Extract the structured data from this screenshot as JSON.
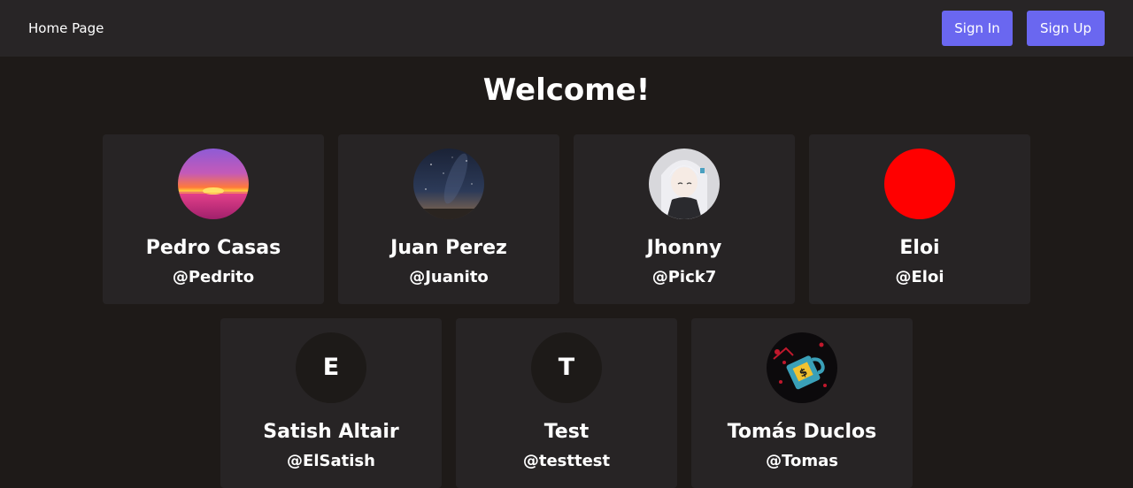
{
  "nav": {
    "home_label": "Home Page",
    "sign_in_label": "Sign In",
    "sign_up_label": "Sign Up",
    "button_color": "#6a67f0"
  },
  "title": "Welcome!",
  "users": [
    {
      "name": "Pedro Casas",
      "handle": "@Pedrito",
      "avatar": "sunset-photo"
    },
    {
      "name": "Juan Perez",
      "handle": "@Juanito",
      "avatar": "night-sky-photo"
    },
    {
      "name": "Jhonny",
      "handle": "@Pick7",
      "avatar": "anime-character-drawing"
    },
    {
      "name": "Eloi",
      "handle": "@Eloi",
      "avatar": "red-circle",
      "avatar_color": "#ff0000"
    },
    {
      "name": "Satish Altair",
      "handle": "@ElSatish",
      "avatar_letter": "E"
    },
    {
      "name": "Test",
      "handle": "@testtest",
      "avatar_letter": "T"
    },
    {
      "name": "Tomás Duclos",
      "handle": "@Tomas",
      "avatar": "mug-illustration"
    }
  ]
}
